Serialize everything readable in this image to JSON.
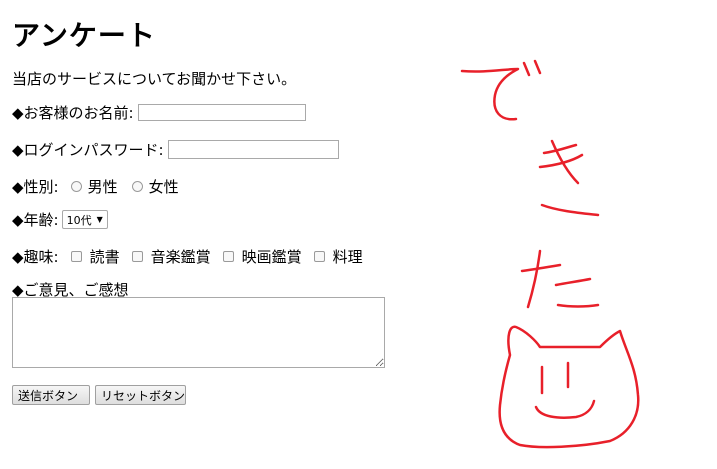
{
  "form": {
    "title": "アンケート",
    "intro": "当店のサービスについてお聞かせ下さい。",
    "name_label": "◆お客様のお名前:",
    "name_value": "",
    "password_label": "◆ログインパスワード:",
    "password_value": "",
    "gender_label": "◆性別:",
    "gender_options": [
      "男性",
      "女性"
    ],
    "age_label": "◆年齢:",
    "age_selected": "10代",
    "hobby_label": "◆趣味:",
    "hobby_options": [
      "読書",
      "音楽鑑賞",
      "映画鑑賞",
      "料理"
    ],
    "comment_label": "◆ご意見、ご感想",
    "comment_value": "",
    "submit_label": "送信ボタン",
    "reset_label": "リセットボタン"
  },
  "annotation": {
    "handwritten_text": "でき た",
    "ink_color": "#e8202a"
  }
}
